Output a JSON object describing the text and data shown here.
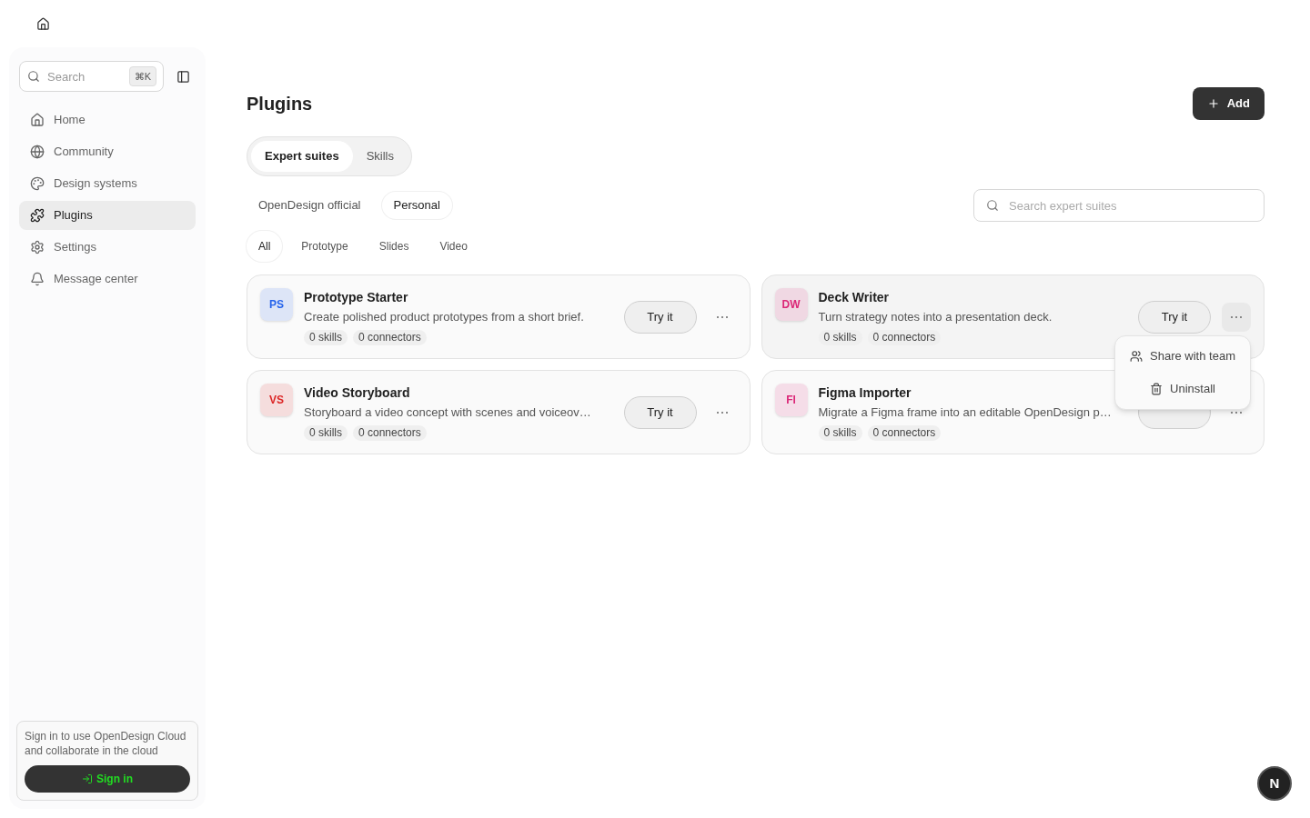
{
  "sidebar": {
    "search": {
      "placeholder": "Search",
      "shortcut": "⌘K"
    },
    "items": [
      {
        "label": "Home",
        "kind": "home",
        "selected": false
      },
      {
        "label": "Community",
        "kind": "globe",
        "selected": false
      },
      {
        "label": "Design systems",
        "kind": "palette",
        "selected": false
      },
      {
        "label": "Plugins",
        "kind": "puzzle",
        "selected": true
      },
      {
        "label": "Settings",
        "kind": "gear",
        "selected": false
      },
      {
        "label": "Message center",
        "kind": "bell",
        "selected": false
      }
    ],
    "signin": {
      "message": "Sign in to use OpenDesign Cloud and collaborate in the cloud",
      "button": "Sign in"
    }
  },
  "page": {
    "title": "Plugins",
    "add_button": "Add"
  },
  "tabs": [
    {
      "label": "Expert suites",
      "selected": true
    },
    {
      "label": "Skills",
      "selected": false
    }
  ],
  "sources": [
    {
      "label": "OpenDesign official",
      "selected": false
    },
    {
      "label": "Personal",
      "selected": true
    }
  ],
  "search": {
    "placeholder": "Search expert suites"
  },
  "categories": [
    {
      "label": "All",
      "selected": true
    },
    {
      "label": "Prototype",
      "selected": false
    },
    {
      "label": "Slides",
      "selected": false
    },
    {
      "label": "Video",
      "selected": false
    }
  ],
  "plugins": [
    {
      "initials": "PS",
      "color": "#2563eb",
      "name": "Prototype Starter",
      "description": "Create polished product prototypes from a short brief.",
      "skills": "0 skills",
      "connectors": "0 connectors",
      "action": "Try it",
      "menu_open": false
    },
    {
      "initials": "DW",
      "color": "#db2777",
      "name": "Deck Writer",
      "description": "Turn strategy notes into a presentation deck.",
      "skills": "0 skills",
      "connectors": "0 connectors",
      "action": "Try it",
      "menu_open": true
    },
    {
      "initials": "VS",
      "color": "#dc2626",
      "name": "Video Storyboard",
      "description": "Storyboard a video concept with scenes and voiceov…",
      "skills": "0 skills",
      "connectors": "0 connectors",
      "action": "Try it",
      "menu_open": false
    },
    {
      "initials": "FI",
      "color": "#db2777",
      "name": "Figma Importer",
      "description": "Migrate a Figma frame into an editable OpenDesign p…",
      "skills": "0 skills",
      "connectors": "0 connectors",
      "menu_open": false
    }
  ],
  "plugin_menu": [
    {
      "label": "Share with team",
      "kind": "share"
    },
    {
      "label": "Uninstall",
      "kind": "trash"
    }
  ],
  "avatar": "N"
}
